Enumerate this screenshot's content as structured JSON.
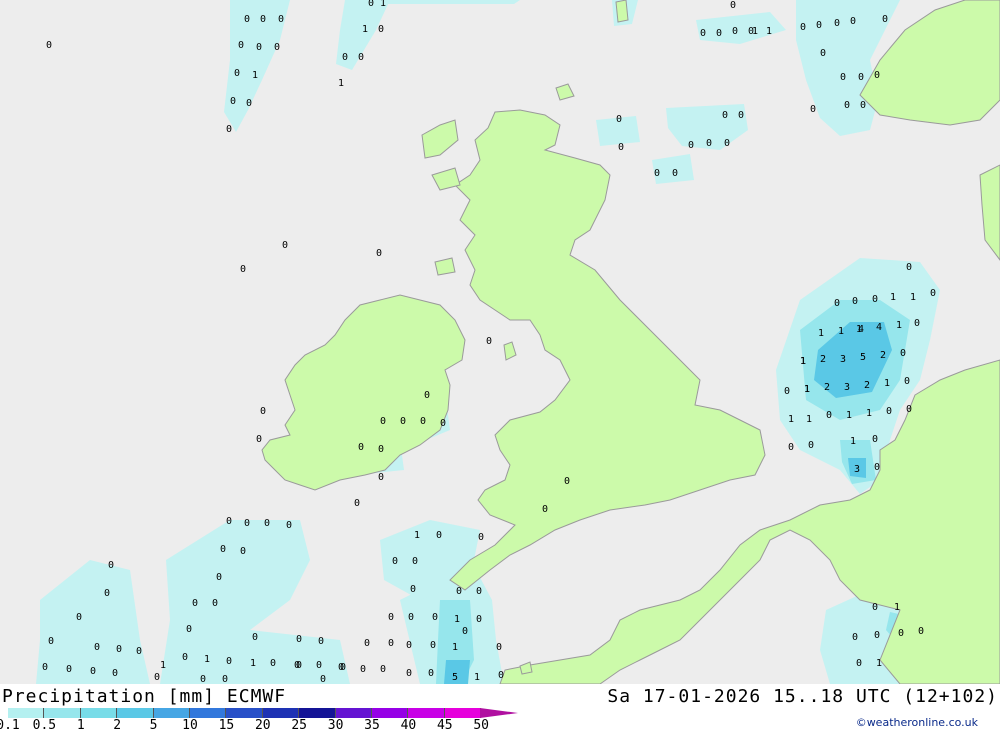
{
  "header": {
    "product": "Precipitation [mm] ECMWF",
    "valid_time": "Sa 17-01-2026 15..18 UTC (12+102)"
  },
  "legend": {
    "ticks": [
      "0.1",
      "0.5",
      "1",
      "2",
      "5",
      "10",
      "15",
      "20",
      "25",
      "30",
      "35",
      "40",
      "45",
      "50"
    ],
    "colors": [
      "#b4f0f0",
      "#96e6ec",
      "#78dce8",
      "#5ac8e6",
      "#46a6e4",
      "#3278dc",
      "#2850c8",
      "#1e32b4",
      "#141496",
      "#6414d2",
      "#9600e6",
      "#c800e6",
      "#e600dc",
      "#b010a0"
    ]
  },
  "credit": "©weatheronline.co.uk",
  "map_colors": {
    "sea": "#ededed",
    "land": "#ccfaaa",
    "coast": "#9a9a9a",
    "light_precip": "#c4f2f2",
    "medium_precip": "#96e6ec",
    "heavy_precip": "#5ac8e6"
  },
  "values": {
    "r1": [
      "0",
      "1"
    ],
    "r2": [
      "0",
      "0",
      "0",
      "1",
      "0"
    ],
    "r3": [
      "0",
      "0",
      "0",
      "0",
      "0",
      "0",
      "0",
      "0",
      "0",
      "0",
      "0",
      "0",
      "0",
      "1",
      "1",
      "0",
      "0",
      "0",
      "0",
      "0"
    ],
    "r4": [
      "0",
      "0",
      "1",
      "0",
      "0"
    ],
    "r5": [
      "1",
      "0",
      "0",
      "0",
      "0",
      "0",
      "0",
      "0"
    ],
    "r6": [
      "0",
      "0",
      "0",
      "0",
      "0",
      "0",
      "0",
      "0",
      "0",
      "0",
      "0",
      "0"
    ],
    "r7": [
      "0",
      "0",
      "0",
      "0"
    ],
    "r8": [
      "0",
      "0",
      "0",
      "1",
      "1",
      "1",
      "1",
      "1",
      "0"
    ],
    "r9": [
      "0",
      "1",
      "1",
      "4",
      "4",
      "1",
      "0",
      "0",
      "0"
    ],
    "r10": [
      "1",
      "2",
      "3",
      "5",
      "2",
      "0",
      "0",
      "0"
    ],
    "r11": [
      "0",
      "1",
      "2",
      "3",
      "2",
      "1",
      "0"
    ],
    "r12": [
      "1",
      "1",
      "0",
      "1",
      "1",
      "0",
      "0",
      "0",
      "0",
      "0",
      "0",
      "0",
      "0",
      "0",
      "0"
    ],
    "r13": [
      "0",
      "0",
      "1",
      "0",
      "0",
      "0",
      "0",
      "0",
      "3",
      "0",
      "0",
      "0"
    ],
    "r14": [
      "0",
      "0",
      "0",
      "0",
      "0",
      "1",
      "0",
      "0",
      "0",
      "0",
      "0",
      "0",
      "0",
      "0",
      "0",
      "0",
      "0",
      "0",
      "0",
      "0",
      "0",
      "1",
      "0",
      "0",
      "0",
      "0",
      "0",
      "0",
      "1",
      "0",
      "0",
      "0",
      "0",
      "0"
    ],
    "r15": [
      "0",
      "0",
      "0",
      "0",
      "0",
      "0",
      "0",
      "1",
      "1",
      "0",
      "1",
      "0",
      "0",
      "0",
      "0",
      "0",
      "0",
      "0",
      "1",
      "0",
      "0",
      "0",
      "0",
      "0",
      "0",
      "0",
      "5",
      "1",
      "1",
      "0"
    ]
  }
}
